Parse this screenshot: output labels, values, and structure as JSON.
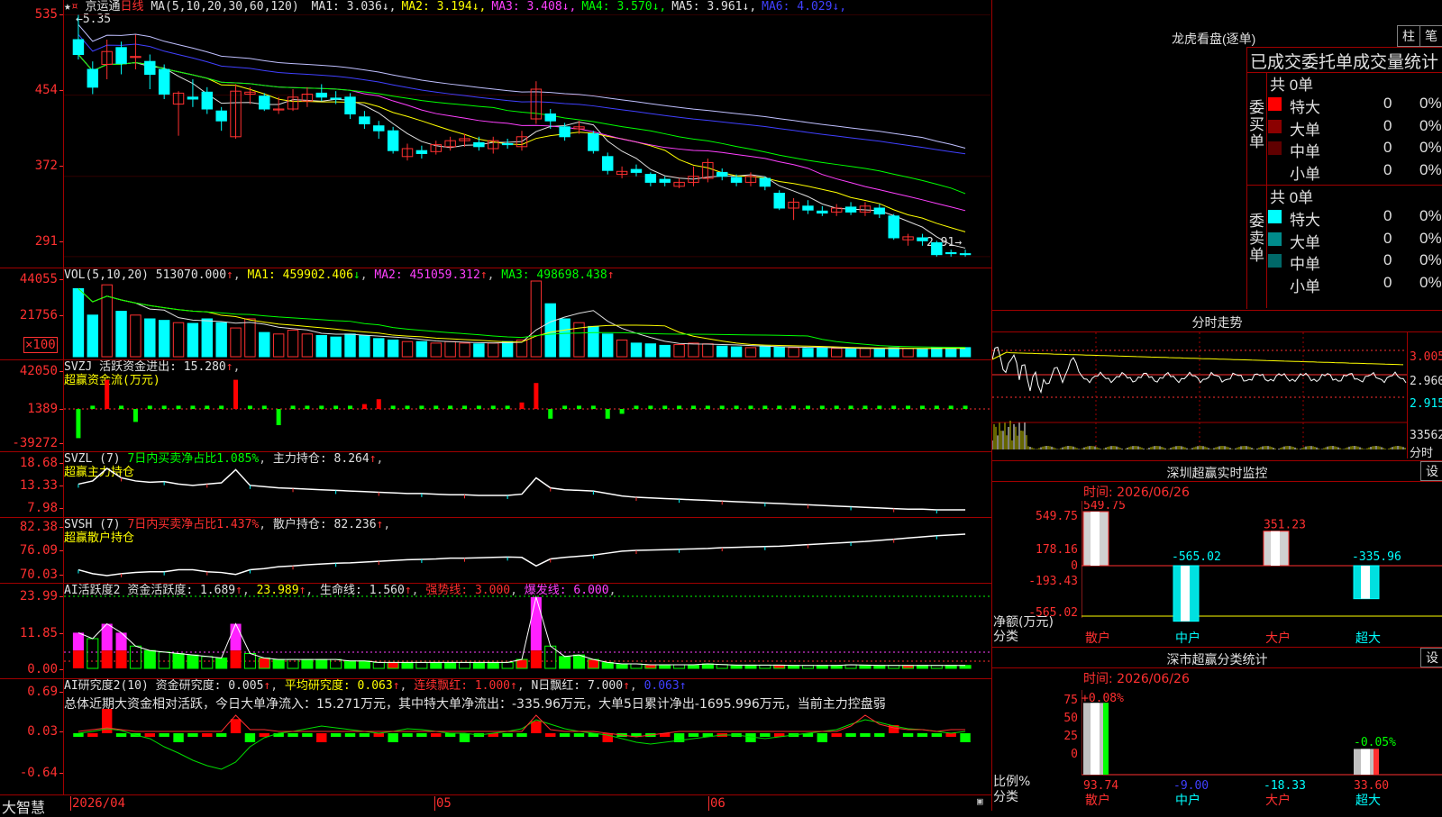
{
  "stock": {
    "name": "京运通",
    "period": "日线",
    "max_price_marker": "5.35",
    "min_price_marker": "2.91",
    "ma_header": "MA(5,10,20,30,60,120)",
    "ma_values": [
      {
        "label": "MA1: 3.036",
        "arrow": "↓",
        "color": "#e0e0e0"
      },
      {
        "label": "MA2: 3.194",
        "arrow": "↓",
        "color": "#ffff00"
      },
      {
        "label": "MA3: 3.408",
        "arrow": "↓",
        "color": "#ff40ff"
      },
      {
        "label": "MA4: 3.570",
        "arrow": "↓",
        "color": "#00ff00"
      },
      {
        "label": "MA5: 3.961",
        "arrow": "↓",
        "color": "#e0e0e0"
      },
      {
        "label": "MA6: 4.029",
        "arrow": "↓",
        "color": "#4040ff"
      }
    ]
  },
  "price_axis": [
    "535",
    "454",
    "372",
    "291"
  ],
  "vol": {
    "header": "VOL(5,10,20)",
    "value": "513070.000",
    "ma1": "MA1: 459902.406",
    "ma2": "MA2: 451059.312",
    "ma3": "MA3: 498698.438",
    "axis": [
      "44055",
      "21756"
    ],
    "unit": "×100"
  },
  "svzj": {
    "header": "SVZJ",
    "line1": "活跃资金进出: 15.280",
    "line2": "超赢资金流(万元)",
    "axis": [
      "42050",
      "1389",
      "-39272"
    ]
  },
  "svzl": {
    "header": "SVZL (7)",
    "ratio": "7日内买卖净占比1.085%",
    "hold": "主力持仓: 8.264",
    "line2": "超赢主力持仓",
    "axis": [
      "18.68",
      "13.33",
      "7.98"
    ]
  },
  "svsh": {
    "header": "SVSH (7)",
    "ratio": "7日内买卖净占比1.437%",
    "hold": "散户持仓: 82.236",
    "line2": "超赢散户持仓",
    "axis": [
      "82.38",
      "76.09",
      "70.03"
    ]
  },
  "ai_active": {
    "header": "AI活跃度2",
    "v1": "资金活跃度: 1.689",
    "v2": "23.989",
    "v3": "生命线: 1.560",
    "v4": "强势线: 3.000",
    "v5": "爆发线: 6.000",
    "axis": [
      "23.99",
      "11.85",
      "0.00"
    ]
  },
  "ai_research": {
    "header": "AI研究度2(10)",
    "v1": "资金研究度: 0.005",
    "v2": "平均研究度: 0.063",
    "v3": "连续飘红: 1.000",
    "v4": "N日飘红: 7.000",
    "v5": "0.063",
    "summary": "总体近期大资金相对活跃，今日大单净流入：15.271万元，其中特大单净流出：-335.96万元，大单5日累计净出-1695.996万元，当前主力控盘弱",
    "axis": [
      "0.69",
      "0.03",
      "-0.64"
    ]
  },
  "x_axis": {
    "d1": "2026/04",
    "d2": "05",
    "d3": "06"
  },
  "brand": "大智慧",
  "lhb": {
    "title": "龙虎看盘(逐单)",
    "btn1": "柱",
    "btn2": "笔",
    "tabs": "已成交委托单成交量统计",
    "buy_label": "委买单",
    "sell_label": "委卖单",
    "buy_total": "共 0单",
    "sell_total": "共 0单",
    "buy_rows": [
      {
        "name": "特大",
        "v": "0",
        "p": "0%",
        "color": "#ff0000"
      },
      {
        "name": "大单",
        "v": "0",
        "p": "0%",
        "color": "#8b0000"
      },
      {
        "name": "中单",
        "v": "0",
        "p": "0%",
        "color": "#600000"
      },
      {
        "name": "小单",
        "v": "0",
        "p": "0%",
        "color": ""
      }
    ],
    "sell_rows": [
      {
        "name": "特大",
        "v": "0",
        "p": "0%",
        "color": "#00ffff"
      },
      {
        "name": "大单",
        "v": "0",
        "p": "0%",
        "color": "#008b8b"
      },
      {
        "name": "中单",
        "v": "0",
        "p": "0%",
        "color": "#006868"
      },
      {
        "name": "小单",
        "v": "0",
        "p": "0%",
        "color": ""
      }
    ]
  },
  "intraday": {
    "title": "分时走势",
    "axis": [
      "3.005",
      "2.960",
      "2.915"
    ],
    "vol_label": "33562",
    "vol_unit": "分时"
  },
  "sz_monitor": {
    "title": "深圳超赢实时监控",
    "btn": "设",
    "time": "时间: 2026/06/26",
    "axis": [
      "549.75",
      "178.16",
      "0",
      "-193.43",
      "-565.02"
    ],
    "ylabel1": "净额(万元)",
    "ylabel2": "分类",
    "bars": [
      {
        "cat": "散户",
        "value": 549.75,
        "label": "549.75"
      },
      {
        "cat": "中户",
        "value": -565.02,
        "label": "-565.02"
      },
      {
        "cat": "大户",
        "value": 351.23,
        "label": "351.23"
      },
      {
        "cat": "超大",
        "value": -335.96,
        "label": "-335.96"
      }
    ]
  },
  "sz_class": {
    "title": "深市超赢分类统计",
    "btn": "设",
    "time": "时间: 2026/06/26",
    "axis": [
      "75",
      "50",
      "25",
      "0"
    ],
    "ylabel1": "比例%",
    "ylabel2": "分类",
    "top1": "+0.08%",
    "top4": "-0.05%",
    "bars": [
      {
        "cat": "散户",
        "value": 93.74,
        "label": "93.74"
      },
      {
        "cat": "中户",
        "value": -9.0,
        "label": "-9.00"
      },
      {
        "cat": "大户",
        "value": -18.33,
        "label": "-18.33"
      },
      {
        "cat": "超大",
        "value": 33.6,
        "label": "33.60"
      }
    ]
  },
  "chart_data": {
    "type": "bar",
    "candles": [
      {
        "o": 5.1,
        "c": 4.95,
        "h": 5.35,
        "l": 4.9
      },
      {
        "o": 4.8,
        "c": 4.62,
        "h": 4.88,
        "l": 4.55
      },
      {
        "o": 4.85,
        "c": 4.98,
        "h": 5.1,
        "l": 4.7
      },
      {
        "o": 5.02,
        "c": 4.86,
        "h": 5.08,
        "l": 4.75
      },
      {
        "o": 4.92,
        "c": 4.93,
        "h": 5.15,
        "l": 4.8
      },
      {
        "o": 4.88,
        "c": 4.75,
        "h": 4.95,
        "l": 4.6
      },
      {
        "o": 4.8,
        "c": 4.55,
        "h": 4.85,
        "l": 4.5
      },
      {
        "o": 4.45,
        "c": 4.56,
        "h": 4.58,
        "l": 4.13
      },
      {
        "o": 4.52,
        "c": 4.5,
        "h": 4.7,
        "l": 4.42
      },
      {
        "o": 4.57,
        "c": 4.4,
        "h": 4.62,
        "l": 4.35
      },
      {
        "o": 4.38,
        "c": 4.28,
        "h": 4.42,
        "l": 4.18
      },
      {
        "o": 4.12,
        "c": 4.58,
        "h": 4.65,
        "l": 4.1
      },
      {
        "o": 4.55,
        "c": 4.57,
        "h": 4.62,
        "l": 4.45
      },
      {
        "o": 4.53,
        "c": 4.4,
        "h": 4.56,
        "l": 4.38
      },
      {
        "o": 4.39,
        "c": 4.4,
        "h": 4.52,
        "l": 4.35
      },
      {
        "o": 4.4,
        "c": 4.52,
        "h": 4.6,
        "l": 4.38
      },
      {
        "o": 4.48,
        "c": 4.55,
        "h": 4.62,
        "l": 4.42
      },
      {
        "o": 4.56,
        "c": 4.52,
        "h": 4.65,
        "l": 4.48
      },
      {
        "o": 4.51,
        "c": 4.5,
        "h": 4.58,
        "l": 4.45
      },
      {
        "o": 4.52,
        "c": 4.35,
        "h": 4.56,
        "l": 4.3
      },
      {
        "o": 4.32,
        "c": 4.25,
        "h": 4.38,
        "l": 4.2
      },
      {
        "o": 4.23,
        "c": 4.18,
        "h": 4.28,
        "l": 4.1
      },
      {
        "o": 4.18,
        "c": 3.98,
        "h": 4.22,
        "l": 3.95
      },
      {
        "o": 3.92,
        "c": 4.0,
        "h": 4.05,
        "l": 3.88
      },
      {
        "o": 3.98,
        "c": 3.95,
        "h": 4.03,
        "l": 3.9
      },
      {
        "o": 3.97,
        "c": 4.04,
        "h": 4.08,
        "l": 3.94
      },
      {
        "o": 4.02,
        "c": 4.08,
        "h": 4.12,
        "l": 3.98
      },
      {
        "o": 4.08,
        "c": 4.1,
        "h": 4.15,
        "l": 4.02
      },
      {
        "o": 4.06,
        "c": 4.02,
        "h": 4.12,
        "l": 3.98
      },
      {
        "o": 4.0,
        "c": 4.08,
        "h": 4.12,
        "l": 3.95
      },
      {
        "o": 4.05,
        "c": 4.04,
        "h": 4.1,
        "l": 4.0
      },
      {
        "o": 4.02,
        "c": 4.12,
        "h": 4.18,
        "l": 3.98
      },
      {
        "o": 4.3,
        "c": 4.6,
        "h": 4.68,
        "l": 4.25
      },
      {
        "o": 4.35,
        "c": 4.28,
        "h": 4.4,
        "l": 4.2
      },
      {
        "o": 4.22,
        "c": 4.12,
        "h": 4.26,
        "l": 4.08
      },
      {
        "o": 4.2,
        "c": 4.22,
        "h": 4.28,
        "l": 4.15
      },
      {
        "o": 4.15,
        "c": 3.98,
        "h": 4.18,
        "l": 3.95
      },
      {
        "o": 3.92,
        "c": 3.78,
        "h": 3.96,
        "l": 3.74
      },
      {
        "o": 3.74,
        "c": 3.77,
        "h": 3.82,
        "l": 3.7
      },
      {
        "o": 3.79,
        "c": 3.76,
        "h": 3.84,
        "l": 3.72
      },
      {
        "o": 3.74,
        "c": 3.66,
        "h": 3.76,
        "l": 3.62
      },
      {
        "o": 3.69,
        "c": 3.66,
        "h": 3.72,
        "l": 3.62
      },
      {
        "o": 3.62,
        "c": 3.66,
        "h": 3.7,
        "l": 3.6
      },
      {
        "o": 3.66,
        "c": 3.72,
        "h": 3.82,
        "l": 3.62
      },
      {
        "o": 3.7,
        "c": 3.86,
        "h": 3.9,
        "l": 3.66
      },
      {
        "o": 3.76,
        "c": 3.72,
        "h": 3.8,
        "l": 3.68
      },
      {
        "o": 3.71,
        "c": 3.66,
        "h": 3.74,
        "l": 3.62
      },
      {
        "o": 3.66,
        "c": 3.72,
        "h": 3.76,
        "l": 3.62
      },
      {
        "o": 3.7,
        "c": 3.62,
        "h": 3.72,
        "l": 3.58
      },
      {
        "o": 3.55,
        "c": 3.4,
        "h": 3.58,
        "l": 3.38
      },
      {
        "o": 3.4,
        "c": 3.46,
        "h": 3.5,
        "l": 3.28
      },
      {
        "o": 3.42,
        "c": 3.38,
        "h": 3.48,
        "l": 3.34
      },
      {
        "o": 3.37,
        "c": 3.35,
        "h": 3.42,
        "l": 3.32
      },
      {
        "o": 3.36,
        "c": 3.4,
        "h": 3.44,
        "l": 3.32
      },
      {
        "o": 3.41,
        "c": 3.36,
        "h": 3.46,
        "l": 3.33
      },
      {
        "o": 3.36,
        "c": 3.42,
        "h": 3.46,
        "l": 3.32
      },
      {
        "o": 3.4,
        "c": 3.34,
        "h": 3.44,
        "l": 3.3
      },
      {
        "o": 3.32,
        "c": 3.1,
        "h": 3.34,
        "l": 3.08
      },
      {
        "o": 3.08,
        "c": 3.11,
        "h": 3.14,
        "l": 3.02
      },
      {
        "o": 3.1,
        "c": 3.07,
        "h": 3.14,
        "l": 3.02
      },
      {
        "o": 3.05,
        "c": 2.93,
        "h": 3.07,
        "l": 2.91
      },
      {
        "o": 2.95,
        "c": 2.94,
        "h": 2.98,
        "l": 2.91
      },
      {
        "o": 2.94,
        "c": 2.93,
        "h": 2.98,
        "l": 2.91
      }
    ],
    "ylim": [
      2.8,
      5.5
    ]
  }
}
